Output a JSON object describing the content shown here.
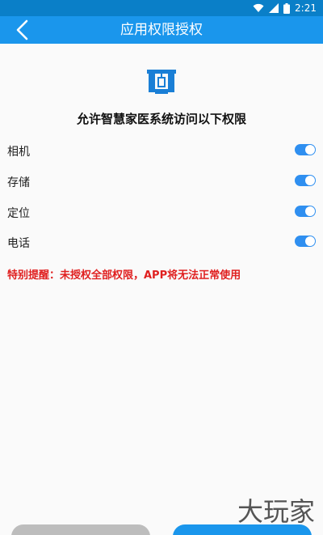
{
  "status_bar": {
    "time": "2:21",
    "icons": [
      "wifi-icon",
      "signal-icon",
      "battery-icon"
    ]
  },
  "app_bar": {
    "title": "应用权限授权",
    "back_icon": "chevron-left-icon"
  },
  "headline": "允许智慧家医系统访问以下权限",
  "permissions": [
    {
      "label": "相机",
      "enabled": true
    },
    {
      "label": "存储",
      "enabled": true
    },
    {
      "label": "定位",
      "enabled": true
    },
    {
      "label": "电话",
      "enabled": true
    }
  ],
  "warning": "特别提醒：未授权全部权限，APP将无法正常使用",
  "watermark": "大玩家",
  "colors": {
    "status_bar": "#0a7fc8",
    "app_bar": "#1a96ec",
    "toggle_on": "#2f8ff0",
    "warning": "#e02020",
    "button_secondary": "#bdbdbd",
    "button_primary": "#1a96ec"
  }
}
